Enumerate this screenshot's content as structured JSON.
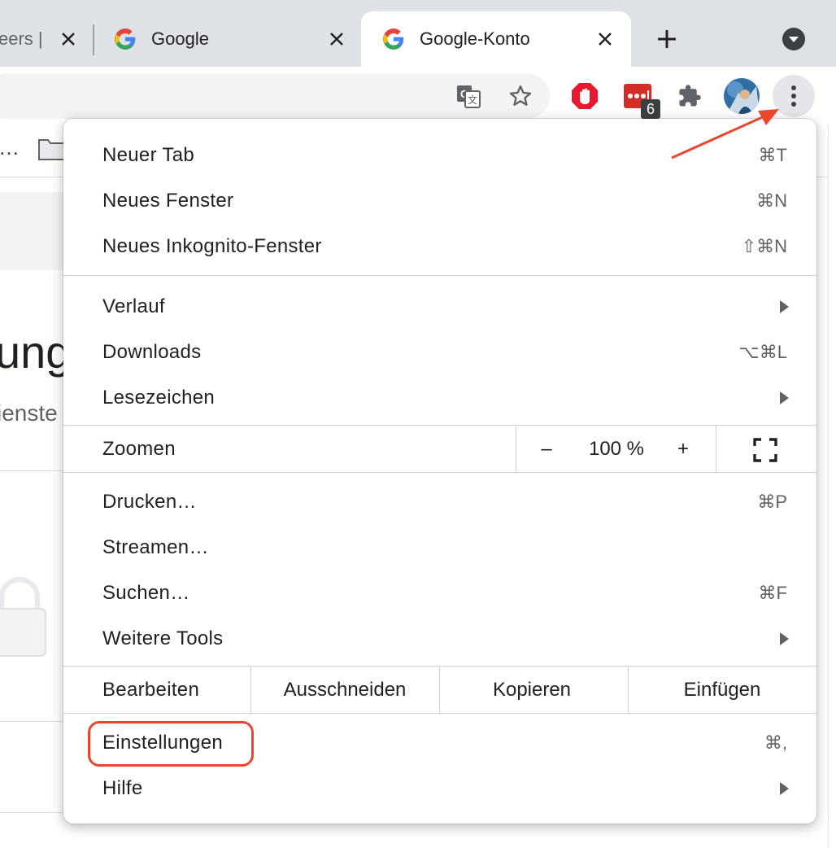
{
  "tabs": [
    {
      "label": "eers |",
      "active": false
    },
    {
      "label": "Google",
      "active": false
    },
    {
      "label": "Google-Konto",
      "active": true
    }
  ],
  "toolbar": {
    "extension_badge_count": "6",
    "icons": [
      "translate-icon",
      "star-icon",
      "adblock-icon",
      "lastpass-icon",
      "extensions-icon",
      "avatar",
      "kebab-menu-icon"
    ]
  },
  "bookmarks": {
    "overflow_label": "…"
  },
  "page": {
    "heading_fragment": "ung",
    "subtitle_fragment": "ienste"
  },
  "menu": {
    "group1": [
      {
        "label": "Neuer Tab",
        "shortcut": "⌘T"
      },
      {
        "label": "Neues Fenster",
        "shortcut": "⌘N"
      },
      {
        "label": "Neues Inkognito-Fenster",
        "shortcut": "⇧⌘N"
      }
    ],
    "group2": [
      {
        "label": "Verlauf",
        "submenu": true
      },
      {
        "label": "Downloads",
        "shortcut": "⌥⌘L"
      },
      {
        "label": "Lesezeichen",
        "submenu": true
      }
    ],
    "zoom": {
      "label": "Zoomen",
      "minus": "–",
      "value": "100 %",
      "plus": "+"
    },
    "group3": [
      {
        "label": "Drucken…",
        "shortcut": "⌘P"
      },
      {
        "label": "Streamen…"
      },
      {
        "label": "Suchen…",
        "shortcut": "⌘F"
      },
      {
        "label": "Weitere Tools",
        "submenu": true
      }
    ],
    "edit": {
      "label": "Bearbeiten",
      "cut": "Ausschneiden",
      "copy": "Kopieren",
      "paste": "Einfügen"
    },
    "group4": [
      {
        "label": "Einstellungen",
        "shortcut": "⌘,"
      },
      {
        "label": "Hilfe",
        "submenu": true
      }
    ]
  },
  "colors": {
    "annotation": "#e8472e",
    "tabstrip": "#dee1e6",
    "menu_bg": "#ffffff"
  }
}
